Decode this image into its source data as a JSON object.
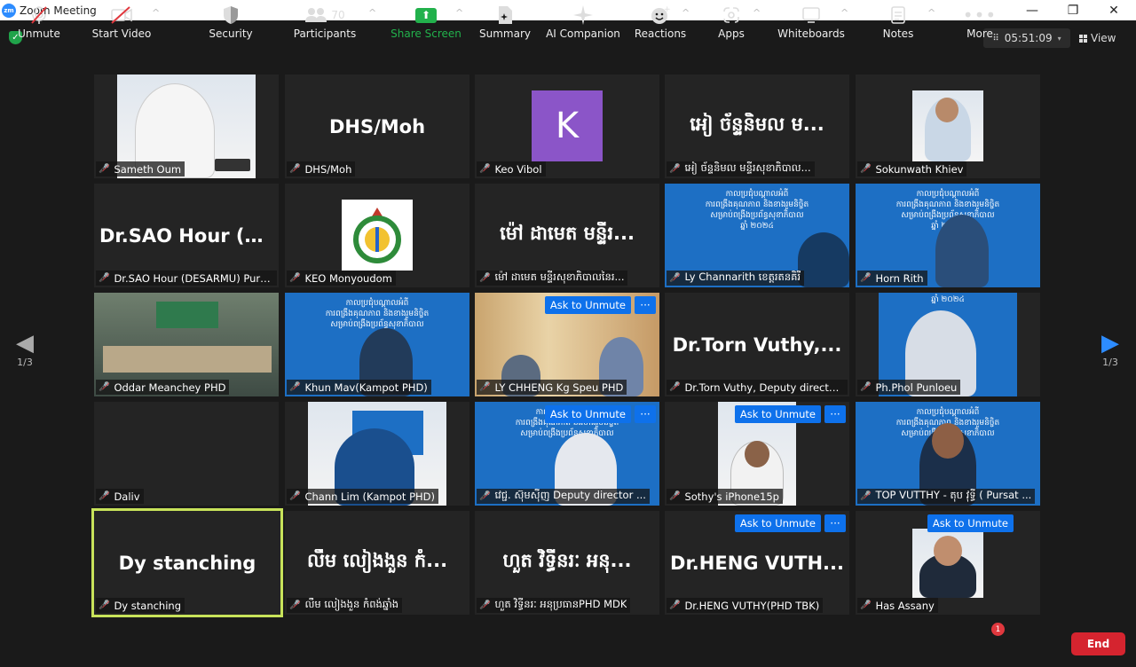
{
  "window": {
    "title": "Zoom Meeting",
    "minimize": "—",
    "restore": "❐",
    "close": "✕"
  },
  "topbar": {
    "time": "05:51:09",
    "view_label": "View"
  },
  "pager": {
    "left": "1/3",
    "right": "1/3"
  },
  "ask_to_unmute": "Ask to Unmute",
  "more_dots": "···",
  "tiles": [
    {
      "name": "Sameth Oum"
    },
    {
      "name": "DHS/Moh",
      "display": "DHS/Moh"
    },
    {
      "name": "Keo Vibol",
      "avatar": "K"
    },
    {
      "name": "អៀ ច័ន្ទនិមល មន្ទីរសុខាភិបាល...",
      "display": "អៀ ច័ន្ទនិមល ម..."
    },
    {
      "name": "Sokunwath Khiev"
    },
    {
      "name": "Dr.SAO Hour (DESARMU) Pursa...",
      "display": "Dr.SAO Hour (D..."
    },
    {
      "name": "KEO Monyoudom"
    },
    {
      "name": "ម៉ៅ ដាមេត មន្ទីរសុខាភិបាលនៃរ...",
      "display": "ម៉ៅ ដាមេត មន្ទីរ..."
    },
    {
      "name": "Ly Channarith ខេត្តរតនគិរី"
    },
    {
      "name": "Horn Rith"
    },
    {
      "name": "Oddar Meanchey PHD"
    },
    {
      "name": "Khun Mav(Kampot PHD)"
    },
    {
      "name": "LY CHHENG Kg Speu PHD"
    },
    {
      "name": "Dr.Torn Vuthy, Deputy director ...",
      "display": "Dr.Torn Vuthy,..."
    },
    {
      "name": "Ph.Phol Punloeu"
    },
    {
      "name": "Daliv"
    },
    {
      "name": "Chann Lim (Kampot PHD)"
    },
    {
      "name": "វេជ្ជ. ស៊ុមស៊ីញ Deputy director ..."
    },
    {
      "name": "Sothy's iPhone15p"
    },
    {
      "name": "TOP VUTTHY - តុប វុទ្ធី ( Pursat ...",
      "display": ""
    },
    {
      "name": "Dy stanching",
      "display": "Dy stanching"
    },
    {
      "name": "លឹម លៀងងួន កំពង់ឆ្នាំង",
      "display": "លឹម លៀងងួន កំ..."
    },
    {
      "name": "ហួត វិទ្ធីនរៈ អនុប្រធានPHD MDK",
      "display": "ហួត វិទ្ធីនរៈ អនុ..."
    },
    {
      "name": "Dr.HENG VUTHY(PHD TBK)",
      "display": "Dr.HENG VUTH..."
    },
    {
      "name": "Has Assany"
    }
  ],
  "slide": {
    "line1": "កាលប្រជុំបណ្តាលអំពី",
    "line2": "ការពង្រឹងគុណភាព និងខាងរួមនិច្ចិត",
    "line3": "សម្រាប់ពង្រឹងប្រព័ន្ធសុខាភិបាល",
    "line4": "ឆ្នាំ ២០២៤"
  },
  "toolbar": {
    "unmute": "Unmute",
    "start_video": "Start Video",
    "security": "Security",
    "participants": "Participants",
    "participants_count": "70",
    "share_screen": "Share Screen",
    "summary": "Summary",
    "ai_companion": "AI Companion",
    "reactions": "Reactions",
    "apps": "Apps",
    "whiteboards": "Whiteboards",
    "notes": "Notes",
    "more": "More",
    "more_badge": "1",
    "end": "End"
  },
  "colors": {
    "accent": "#0e71eb",
    "end": "#d5242f",
    "share": "#22b14c",
    "speaker_outline": "#c8e35a"
  }
}
